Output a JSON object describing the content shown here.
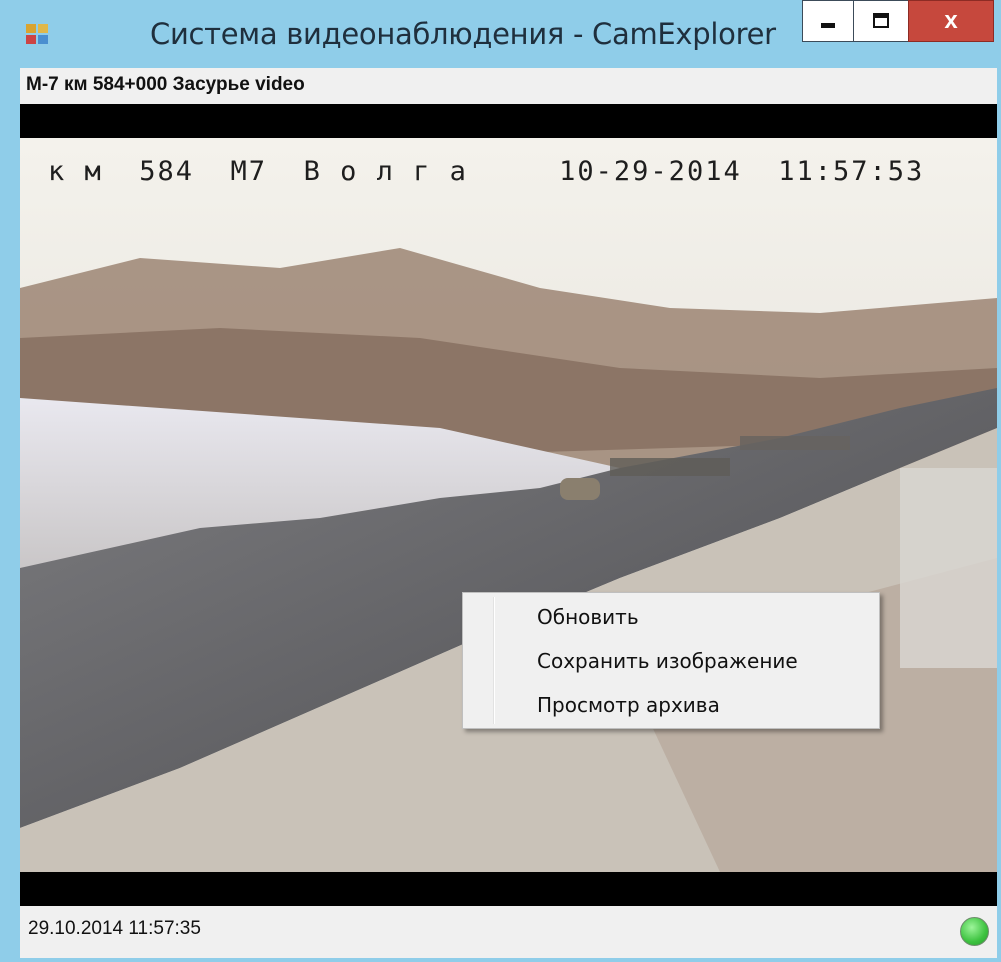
{
  "window": {
    "title": "Система видеонаблюдения - CamExplorer",
    "icons": {
      "app": "app-window-icon",
      "minimize": "minimize-icon",
      "maximize": "maximize-icon",
      "close": "close-icon"
    },
    "close_label": "x"
  },
  "camera": {
    "label": "M-7 км 584+000 Засурье video",
    "osd_text": "к м  584  М7  В о л г а     10-29-2014  11:57:53"
  },
  "context_menu": {
    "items": [
      {
        "label": "Обновить"
      },
      {
        "label": "Сохранить изображение"
      },
      {
        "label": "Просмотр архива"
      }
    ]
  },
  "status": {
    "timestamp": "29.10.2014 11:57:35",
    "indicator_color": "#3cc23f"
  },
  "colors": {
    "frame": "#8fcde9",
    "close_button": "#c6483d"
  }
}
